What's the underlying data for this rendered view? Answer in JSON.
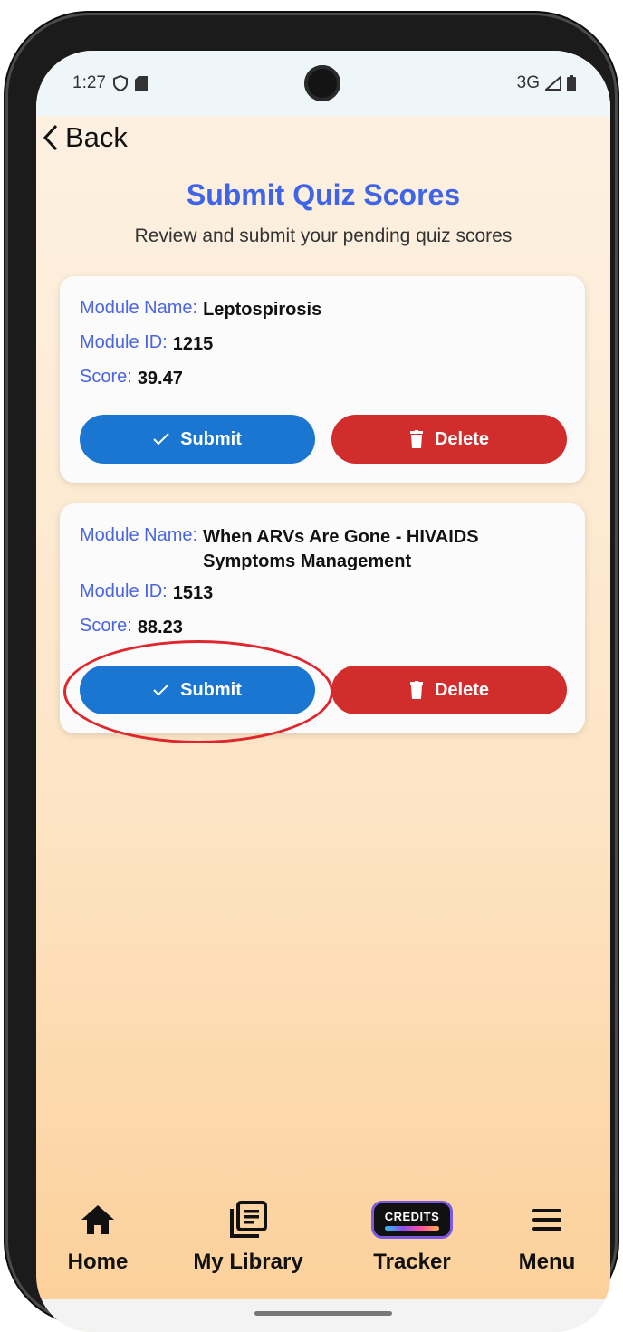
{
  "status_bar": {
    "time": "1:27",
    "network": "3G"
  },
  "header": {
    "back_label": "Back",
    "title": "Submit Quiz Scores",
    "subtitle": "Review and submit your pending quiz scores"
  },
  "labels": {
    "module_name": "Module Name:",
    "module_id": "Module ID:",
    "score": "Score:"
  },
  "cards": [
    {
      "module_name": "Leptospirosis",
      "module_id": "1215",
      "score": "39.47",
      "submit_label": "Submit",
      "delete_label": "Delete"
    },
    {
      "module_name": "When ARVs Are Gone - HIVAIDS Symptoms Management",
      "module_id": "1513",
      "score": "88.23",
      "submit_label": "Submit",
      "delete_label": "Delete",
      "highlighted": true
    }
  ],
  "bottom_nav": [
    {
      "label": "Home",
      "icon": "home-icon"
    },
    {
      "label": "My Library",
      "icon": "library-icon"
    },
    {
      "label": "Tracker",
      "icon": "credits-icon",
      "badge": "CREDITS"
    },
    {
      "label": "Menu",
      "icon": "menu-icon"
    }
  ],
  "colors": {
    "accent": "#3f64e6",
    "submit": "#1b76d2",
    "delete": "#d12d2d",
    "highlight_ring": "#e0262d"
  }
}
